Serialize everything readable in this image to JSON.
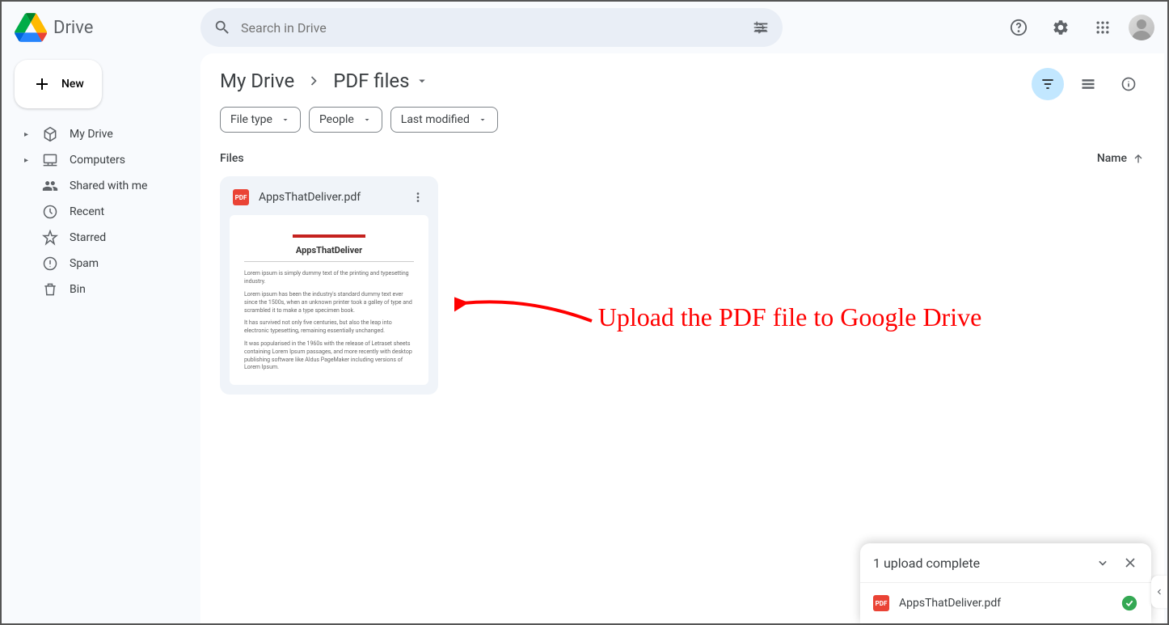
{
  "app": {
    "title": "Drive"
  },
  "search": {
    "placeholder": "Search in Drive"
  },
  "sidebar": {
    "new_label": "New",
    "items": [
      {
        "label": "My Drive",
        "expandable": true
      },
      {
        "label": "Computers",
        "expandable": true
      },
      {
        "label": "Shared with me",
        "expandable": false
      },
      {
        "label": "Recent",
        "expandable": false
      },
      {
        "label": "Starred",
        "expandable": false
      },
      {
        "label": "Spam",
        "expandable": false
      },
      {
        "label": "Bin",
        "expandable": false
      }
    ]
  },
  "breadcrumb": {
    "root": "My Drive",
    "current": "PDF files"
  },
  "filters": {
    "file_type": "File type",
    "people": "People",
    "last_modified": "Last modified"
  },
  "section": {
    "files_label": "Files",
    "sort_label": "Name"
  },
  "files": [
    {
      "name": "AppsThatDeliver.pdf",
      "preview_title": "AppsThatDeliver"
    }
  ],
  "annotation": {
    "text": "Upload the PDF file to Google Drive"
  },
  "toast": {
    "title": "1 upload complete",
    "item_name": "AppsThatDeliver.pdf"
  }
}
